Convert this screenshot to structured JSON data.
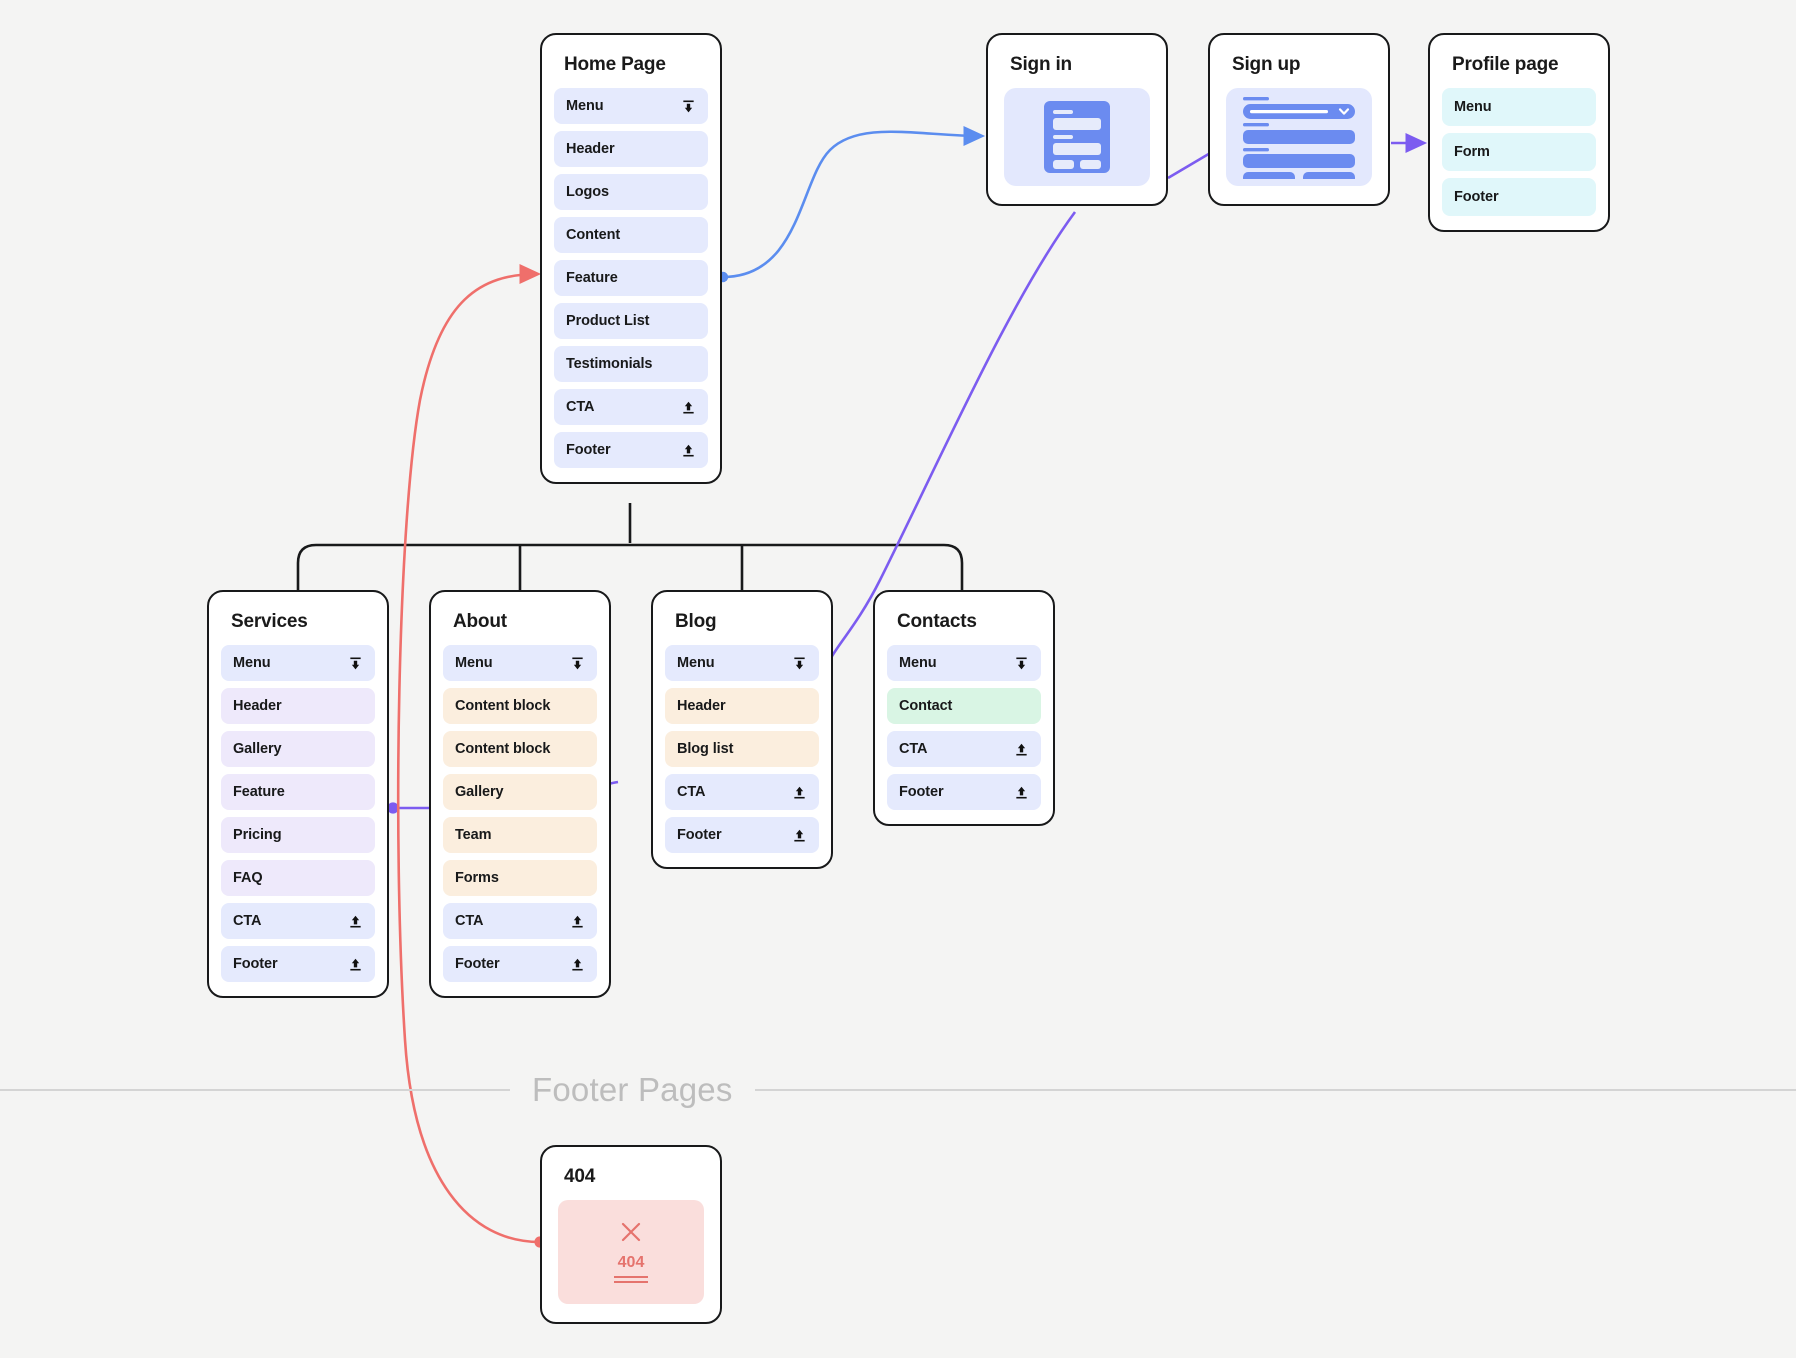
{
  "canvas": {
    "background": "#f4f4f3"
  },
  "divider": {
    "title": "Footer Pages",
    "color": "#bdbdbd",
    "rule_color": "#d4d4d4"
  },
  "palette": {
    "nav_blue": "#e5eafd",
    "content_purple": "#eee9fb",
    "content_orange": "#fbeede",
    "content_green": "#d9f5e4",
    "profile_cyan": "#e0f7fa",
    "error_red_bg": "#fadedc",
    "error_red_fg": "#e5736d",
    "card_border": "#18191a",
    "edge_blue": "#5b8def",
    "edge_purple": "#7c5cf0",
    "edge_red": "#ef6f6b"
  },
  "cards": {
    "home": {
      "title": "Home Page",
      "rows": [
        {
          "label": "Menu",
          "style": "nav",
          "icon": "pin-top-icon"
        },
        {
          "label": "Header",
          "style": "nav",
          "icon": null
        },
        {
          "label": "Logos",
          "style": "nav",
          "icon": null
        },
        {
          "label": "Content",
          "style": "nav",
          "icon": null
        },
        {
          "label": "Feature",
          "style": "nav",
          "icon": null
        },
        {
          "label": "Product List",
          "style": "nav",
          "icon": null
        },
        {
          "label": "Testimonials",
          "style": "nav",
          "icon": null
        },
        {
          "label": "CTA",
          "style": "nav",
          "icon": "pin-bottom-icon"
        },
        {
          "label": "Footer",
          "style": "nav",
          "icon": "pin-bottom-icon"
        }
      ]
    },
    "signin": {
      "title": "Sign in",
      "illustration": "login-form-illustration"
    },
    "signup": {
      "title": "Sign up",
      "illustration": "signup-form-illustration"
    },
    "profile": {
      "title": "Profile page",
      "rows": [
        {
          "label": "Menu",
          "style": "cyan",
          "icon": null
        },
        {
          "label": "Form",
          "style": "cyan",
          "icon": null
        },
        {
          "label": "Footer",
          "style": "cyan",
          "icon": null
        }
      ]
    },
    "services": {
      "title": "Services",
      "rows": [
        {
          "label": "Menu",
          "style": "nav",
          "icon": "pin-top-icon"
        },
        {
          "label": "Header",
          "style": "purple",
          "icon": null
        },
        {
          "label": "Gallery",
          "style": "purple",
          "icon": null
        },
        {
          "label": "Feature",
          "style": "purple",
          "icon": null
        },
        {
          "label": "Pricing",
          "style": "purple",
          "icon": null
        },
        {
          "label": "FAQ",
          "style": "purple",
          "icon": null
        },
        {
          "label": "CTA",
          "style": "nav",
          "icon": "pin-bottom-icon"
        },
        {
          "label": "Footer",
          "style": "nav",
          "icon": "pin-bottom-icon"
        }
      ]
    },
    "about": {
      "title": "About",
      "rows": [
        {
          "label": "Menu",
          "style": "nav",
          "icon": "pin-top-icon"
        },
        {
          "label": "Content block",
          "style": "orange",
          "icon": null
        },
        {
          "label": "Content block",
          "style": "orange",
          "icon": null
        },
        {
          "label": "Gallery",
          "style": "orange",
          "icon": null
        },
        {
          "label": "Team",
          "style": "orange",
          "icon": null
        },
        {
          "label": "Forms",
          "style": "orange",
          "icon": null
        },
        {
          "label": "CTA",
          "style": "nav",
          "icon": "pin-bottom-icon"
        },
        {
          "label": "Footer",
          "style": "nav",
          "icon": "pin-bottom-icon"
        }
      ]
    },
    "blog": {
      "title": "Blog",
      "rows": [
        {
          "label": "Menu",
          "style": "nav",
          "icon": "pin-top-icon"
        },
        {
          "label": "Header",
          "style": "orange",
          "icon": null
        },
        {
          "label": "Blog list",
          "style": "orange",
          "icon": null
        },
        {
          "label": "CTA",
          "style": "nav",
          "icon": "pin-bottom-icon"
        },
        {
          "label": "Footer",
          "style": "nav",
          "icon": "pin-bottom-icon"
        }
      ]
    },
    "contacts": {
      "title": "Contacts",
      "rows": [
        {
          "label": "Menu",
          "style": "nav",
          "icon": "pin-top-icon"
        },
        {
          "label": "Contact",
          "style": "green",
          "icon": null
        },
        {
          "label": "CTA",
          "style": "nav",
          "icon": "pin-bottom-icon"
        },
        {
          "label": "Footer",
          "style": "nav",
          "icon": "pin-bottom-icon"
        }
      ]
    },
    "notfound": {
      "title": "404",
      "illustration": "error-404-illustration",
      "error_code": "404"
    }
  }
}
